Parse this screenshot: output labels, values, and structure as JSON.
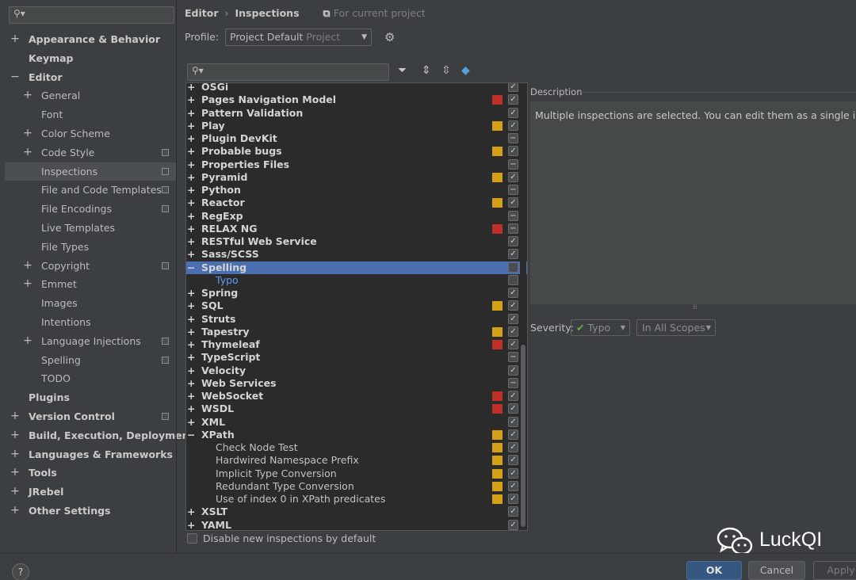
{
  "sidebar": {
    "search_icon": "search-icon",
    "items": [
      {
        "label": "Appearance & Behavior",
        "expander": "+",
        "bold": true,
        "level": 0,
        "copy": false
      },
      {
        "label": "Keymap",
        "expander": "",
        "bold": true,
        "level": 0,
        "copy": false
      },
      {
        "label": "Editor",
        "expander": "−",
        "bold": true,
        "level": 0,
        "copy": false
      },
      {
        "label": "General",
        "expander": "+",
        "bold": false,
        "level": 1,
        "copy": false
      },
      {
        "label": "Font",
        "expander": "",
        "bold": false,
        "level": 1,
        "copy": false
      },
      {
        "label": "Color Scheme",
        "expander": "+",
        "bold": false,
        "level": 1,
        "copy": false
      },
      {
        "label": "Code Style",
        "expander": "+",
        "bold": false,
        "level": 1,
        "copy": true
      },
      {
        "label": "Inspections",
        "expander": "",
        "bold": false,
        "level": 1,
        "copy": true,
        "selected": true
      },
      {
        "label": "File and Code Templates",
        "expander": "",
        "bold": false,
        "level": 1,
        "copy": true
      },
      {
        "label": "File Encodings",
        "expander": "",
        "bold": false,
        "level": 1,
        "copy": true
      },
      {
        "label": "Live Templates",
        "expander": "",
        "bold": false,
        "level": 1,
        "copy": false
      },
      {
        "label": "File Types",
        "expander": "",
        "bold": false,
        "level": 1,
        "copy": false
      },
      {
        "label": "Copyright",
        "expander": "+",
        "bold": false,
        "level": 1,
        "copy": true
      },
      {
        "label": "Emmet",
        "expander": "+",
        "bold": false,
        "level": 1,
        "copy": false
      },
      {
        "label": "Images",
        "expander": "",
        "bold": false,
        "level": 1,
        "copy": false
      },
      {
        "label": "Intentions",
        "expander": "",
        "bold": false,
        "level": 1,
        "copy": false
      },
      {
        "label": "Language Injections",
        "expander": "+",
        "bold": false,
        "level": 1,
        "copy": true
      },
      {
        "label": "Spelling",
        "expander": "",
        "bold": false,
        "level": 1,
        "copy": true
      },
      {
        "label": "TODO",
        "expander": "",
        "bold": false,
        "level": 1,
        "copy": false
      },
      {
        "label": "Plugins",
        "expander": "",
        "bold": true,
        "level": 0,
        "copy": false
      },
      {
        "label": "Version Control",
        "expander": "+",
        "bold": true,
        "level": 0,
        "copy": true
      },
      {
        "label": "Build, Execution, Deployment",
        "expander": "+",
        "bold": true,
        "level": 0,
        "copy": false
      },
      {
        "label": "Languages & Frameworks",
        "expander": "+",
        "bold": true,
        "level": 0,
        "copy": false
      },
      {
        "label": "Tools",
        "expander": "+",
        "bold": true,
        "level": 0,
        "copy": false
      },
      {
        "label": "JRebel",
        "expander": "+",
        "bold": true,
        "level": 0,
        "copy": false
      },
      {
        "label": "Other Settings",
        "expander": "+",
        "bold": true,
        "level": 0,
        "copy": false
      }
    ]
  },
  "header": {
    "breadcrumb_root": "Editor",
    "breadcrumb_sep": "›",
    "breadcrumb_page": "Inspections",
    "scope_note": "For current project",
    "profile_label": "Profile:",
    "profile_value": "Project Default",
    "profile_sub": "Project"
  },
  "toolbar": {
    "filter_icon": "filter-icon",
    "expand_icon": "expand-all-icon",
    "collapse_icon": "collapse-all-icon",
    "reset_icon": "eraser-icon"
  },
  "colors": {
    "severity_red": "#c0302a",
    "severity_yellow": "#d4a017",
    "selection": "#4b6eaf"
  },
  "tree": [
    {
      "label": "OSGi",
      "exp": "+",
      "sev": "",
      "check": "✓"
    },
    {
      "label": "Pages Navigation Model",
      "exp": "+",
      "sev": "red",
      "check": "✓"
    },
    {
      "label": "Pattern Validation",
      "exp": "+",
      "sev": "",
      "check": "✓"
    },
    {
      "label": "Play",
      "exp": "+",
      "sev": "yellow",
      "check": "✓"
    },
    {
      "label": "Plugin DevKit",
      "exp": "+",
      "sev": "",
      "check": "−"
    },
    {
      "label": "Probable bugs",
      "exp": "+",
      "sev": "yellow",
      "check": "✓"
    },
    {
      "label": "Properties Files",
      "exp": "+",
      "sev": "",
      "check": "−"
    },
    {
      "label": "Pyramid",
      "exp": "+",
      "sev": "yellow",
      "check": "✓"
    },
    {
      "label": "Python",
      "exp": "+",
      "sev": "",
      "check": "−"
    },
    {
      "label": "Reactor",
      "exp": "+",
      "sev": "yellow",
      "check": "✓"
    },
    {
      "label": "RegExp",
      "exp": "+",
      "sev": "",
      "check": "−"
    },
    {
      "label": "RELAX NG",
      "exp": "+",
      "sev": "red",
      "check": "−"
    },
    {
      "label": "RESTful Web Service",
      "exp": "+",
      "sev": "",
      "check": "✓"
    },
    {
      "label": "Sass/SCSS",
      "exp": "+",
      "sev": "",
      "check": "✓"
    },
    {
      "label": "Spelling",
      "exp": "−",
      "sev": "",
      "check": "",
      "selected": true
    },
    {
      "label": "Typo",
      "exp": "",
      "sev": "",
      "check": "",
      "child": true,
      "link": true
    },
    {
      "label": "Spring",
      "exp": "+",
      "sev": "",
      "check": "✓"
    },
    {
      "label": "SQL",
      "exp": "+",
      "sev": "yellow",
      "check": "✓"
    },
    {
      "label": "Struts",
      "exp": "+",
      "sev": "",
      "check": "✓"
    },
    {
      "label": "Tapestry",
      "exp": "+",
      "sev": "yellow",
      "check": "✓"
    },
    {
      "label": "Thymeleaf",
      "exp": "+",
      "sev": "red",
      "check": "✓"
    },
    {
      "label": "TypeScript",
      "exp": "+",
      "sev": "",
      "check": "−"
    },
    {
      "label": "Velocity",
      "exp": "+",
      "sev": "",
      "check": "✓"
    },
    {
      "label": "Web Services",
      "exp": "+",
      "sev": "",
      "check": "−"
    },
    {
      "label": "WebSocket",
      "exp": "+",
      "sev": "red",
      "check": "✓"
    },
    {
      "label": "WSDL",
      "exp": "+",
      "sev": "red",
      "check": "✓"
    },
    {
      "label": "XML",
      "exp": "+",
      "sev": "",
      "check": "✓"
    },
    {
      "label": "XPath",
      "exp": "−",
      "sev": "yellow",
      "check": "✓"
    },
    {
      "label": "Check Node Test",
      "exp": "",
      "sev": "yellow",
      "check": "✓",
      "child": true
    },
    {
      "label": "Hardwired Namespace Prefix",
      "exp": "",
      "sev": "yellow",
      "check": "✓",
      "child": true
    },
    {
      "label": "Implicit Type Conversion",
      "exp": "",
      "sev": "yellow",
      "check": "✓",
      "child": true
    },
    {
      "label": "Redundant Type Conversion",
      "exp": "",
      "sev": "yellow",
      "check": "✓",
      "child": true
    },
    {
      "label": "Use of index 0 in XPath predicates",
      "exp": "",
      "sev": "yellow",
      "check": "✓",
      "child": true
    },
    {
      "label": "XSLT",
      "exp": "+",
      "sev": "",
      "check": "✓"
    },
    {
      "label": "YAML",
      "exp": "+",
      "sev": "",
      "check": "✓"
    }
  ],
  "options": {
    "disable_new_label": "Disable new inspections by default"
  },
  "description": {
    "title": "Description",
    "text": "Multiple inspections are selected. You can edit them as a single inspection."
  },
  "severity": {
    "label": "Severity:",
    "value": "Typo",
    "scope": "In All Scopes"
  },
  "watermark": {
    "text": "LuckQI"
  },
  "buttons": {
    "help": "?",
    "ok": "OK",
    "cancel": "Cancel",
    "apply": "Apply"
  }
}
